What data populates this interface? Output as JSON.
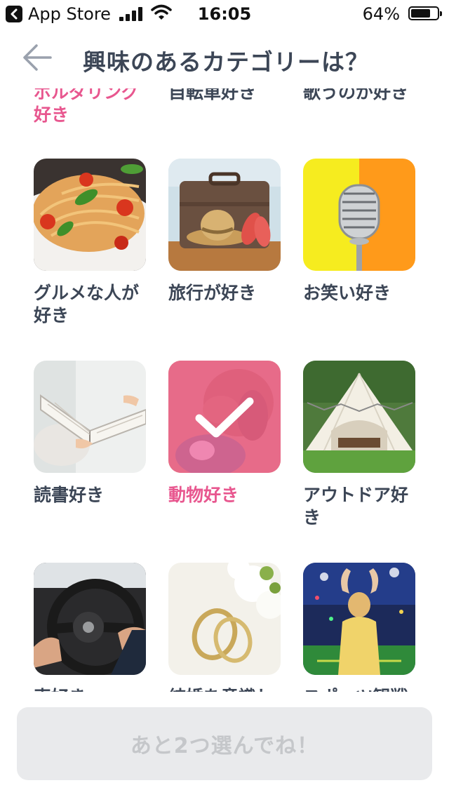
{
  "status_bar": {
    "back_app": "App Store",
    "time": "16:05",
    "battery": "64%"
  },
  "header": {
    "title": "興味のあるカテゴリーは？"
  },
  "partial_row": [
    {
      "label": "ボルダリング好き",
      "selected": true
    },
    {
      "label": "自転車好き",
      "selected": false
    },
    {
      "label": "歌うのが好き",
      "selected": false
    }
  ],
  "categories": [
    {
      "label": "グルメな人が好き",
      "image": "pasta-dish",
      "selected": false
    },
    {
      "label": "旅行が好き",
      "image": "suitcase-hat-sandals",
      "selected": false
    },
    {
      "label": "お笑い好き",
      "image": "vintage-microphone",
      "selected": false
    },
    {
      "label": "読書好き",
      "image": "open-book",
      "selected": false
    },
    {
      "label": "動物好き",
      "image": "dog-and-cat",
      "selected": true
    },
    {
      "label": "アウトドア好き",
      "image": "glamping-tent",
      "selected": false
    },
    {
      "label": "車好き",
      "image": "steering-wheel",
      "selected": false
    },
    {
      "label": "結婚を意識し",
      "image": "wedding-rings",
      "selected": false
    },
    {
      "label": "スポーツ観戦",
      "image": "stadium-fan",
      "selected": false
    }
  ],
  "footer": {
    "cta_label": "あと2つ選んでね！"
  }
}
